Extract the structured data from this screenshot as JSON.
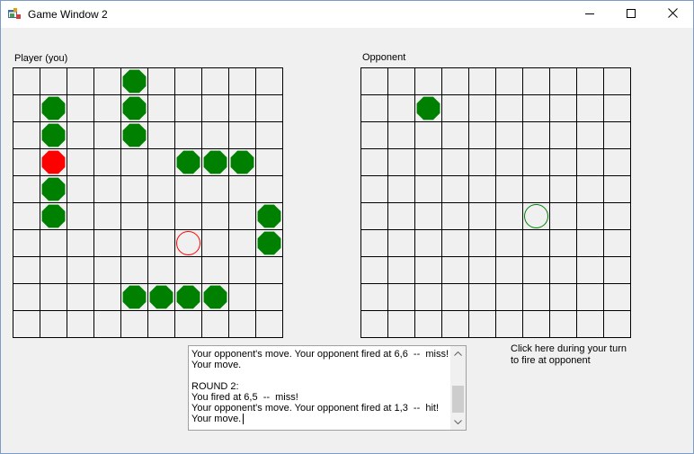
{
  "window": {
    "title": "Game Window 2",
    "icon": "app-window-icon",
    "controls": [
      "minimize-icon",
      "maximize-icon",
      "close-icon"
    ]
  },
  "player": {
    "label": "Player (you)",
    "rows": 10,
    "cols": 10,
    "ships": [
      [
        4,
        0
      ],
      [
        1,
        1
      ],
      [
        4,
        1
      ],
      [
        1,
        2
      ],
      [
        4,
        2
      ],
      [
        6,
        3
      ],
      [
        7,
        3
      ],
      [
        8,
        3
      ],
      [
        1,
        4
      ],
      [
        1,
        5
      ],
      [
        9,
        5
      ],
      [
        9,
        6
      ],
      [
        4,
        8
      ],
      [
        5,
        8
      ],
      [
        6,
        8
      ],
      [
        7,
        8
      ]
    ],
    "hits": [
      [
        1,
        3
      ]
    ],
    "misses": [
      [
        6,
        6
      ]
    ]
  },
  "opponent": {
    "label": "Opponent",
    "rows": 10,
    "cols": 10,
    "hits": [
      [
        2,
        1
      ]
    ],
    "misses": [
      [
        6,
        5
      ]
    ]
  },
  "colors": {
    "ship": "#008000",
    "hit": "#ff0000",
    "miss_player": "#ff0000",
    "miss_opponent": "#008000",
    "grid_line": "#000000"
  },
  "log": {
    "lines": [
      "Your opponent's move. Your opponent fired at 6,6  --  miss!",
      "Your move.",
      "",
      "ROUND 2:",
      "You fired at 6,5  --  miss!",
      "Your opponent's move. Your opponent fired at 1,3  --  hit!",
      "Your move."
    ]
  },
  "hint": {
    "text": "Click here during your turn to fire at opponent"
  }
}
